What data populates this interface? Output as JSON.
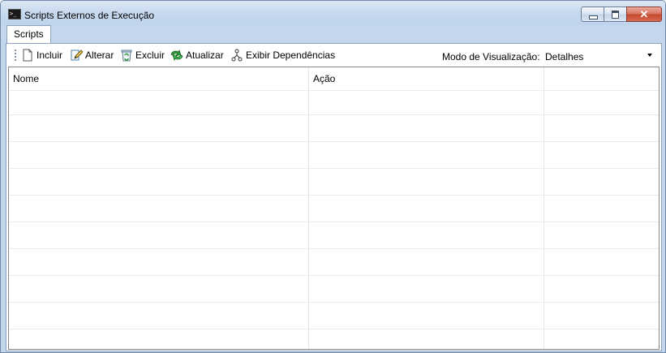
{
  "window": {
    "title": "Scripts Externos de Execução",
    "icon": "terminal-icon",
    "controls": {
      "minimize": "minimize-icon",
      "maximize": "maximize-icon",
      "close": "close-icon",
      "close_glyph": "✕"
    }
  },
  "tabs": [
    {
      "label": "Scripts",
      "active": true
    }
  ],
  "toolbar": {
    "buttons": [
      {
        "label": "Incluir",
        "icon": "new-document-icon"
      },
      {
        "label": "Alterar",
        "icon": "edit-pencil-icon"
      },
      {
        "label": "Excluir",
        "icon": "recycle-bin-icon"
      },
      {
        "label": "Atualizar",
        "icon": "refresh-arrow-icon"
      },
      {
        "label": "Exibir Dependências",
        "icon": "dependency-tree-icon"
      }
    ],
    "view_mode_label": "Modo de Visualização:",
    "view_mode_value": "Detalhes"
  },
  "list": {
    "columns": [
      "Nome",
      "Ação",
      ""
    ],
    "rows": []
  },
  "colors": {
    "titlebar": "#c7d9ee",
    "close_button": "#c4462c",
    "grid_line": "#ececec"
  }
}
